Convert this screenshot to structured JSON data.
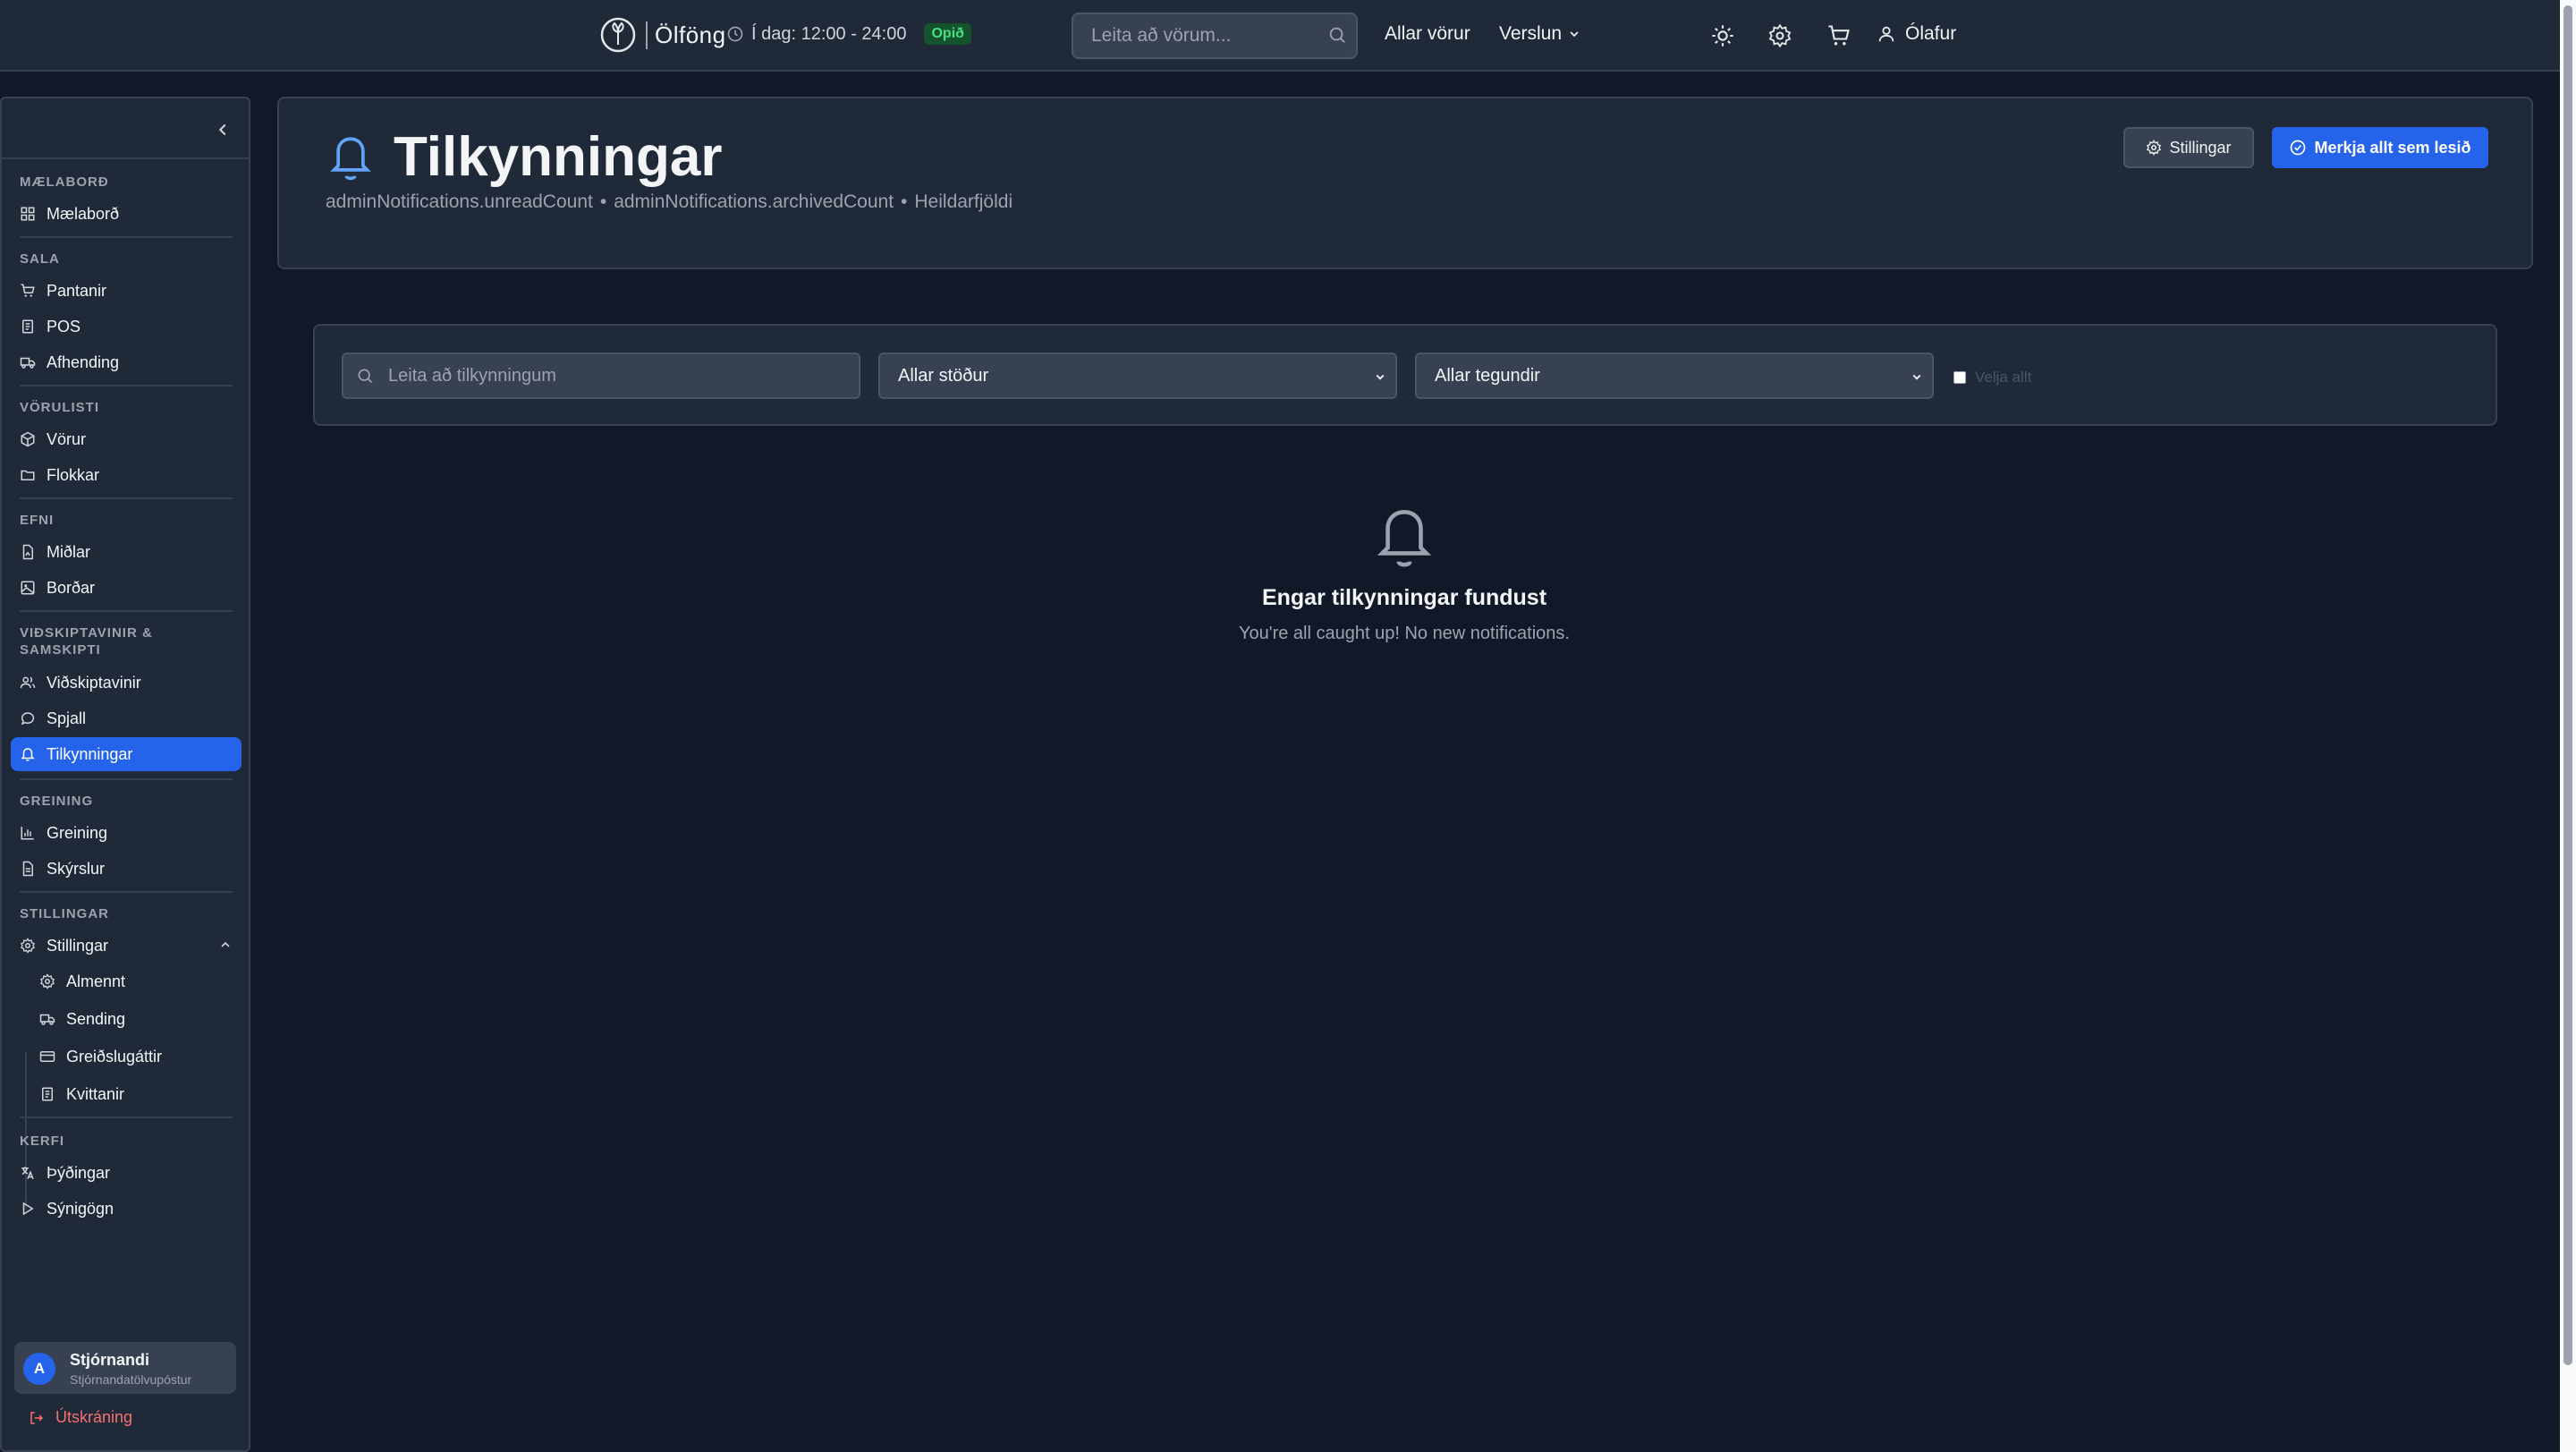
{
  "topbar": {
    "brand": "Ölföng",
    "hours": "Í dag: 12:00 - 24:00",
    "open_badge": "Opið",
    "search_placeholder": "Leita að vörum...",
    "nav_all_products": "Allar vörur",
    "nav_store": "Verslun",
    "user_name": "Ólafur",
    "icons": [
      "clock-icon",
      "search-icon",
      "sun-icon",
      "gear-icon",
      "cart-icon",
      "user-icon"
    ]
  },
  "sidebar": {
    "groups": {
      "dashboard": "MÆLABORÐ",
      "sales": "SALA",
      "catalog": "VÖRULISTI",
      "content": "EFNI",
      "customers": "VIÐSKIPTAVINIR & SAMSKIPTI",
      "analytics": "GREINING",
      "settings": "STILLINGAR",
      "system": "KERFI"
    },
    "items": {
      "dashboard": "Mælaborð",
      "orders": "Pantanir",
      "pos": "POS",
      "delivery": "Afhending",
      "products": "Vörur",
      "categories": "Flokkar",
      "media": "Miðlar",
      "banners": "Borðar",
      "customers": "Viðskiptavinir",
      "chat": "Spjall",
      "notifications": "Tilkynningar",
      "analytics": "Greining",
      "reports": "Skýrslur",
      "settings": "Stillingar",
      "general": "Almennt",
      "shipping": "Sending",
      "payment_methods": "Greiðslugáttir",
      "receipts": "Kvittanir",
      "translations": "Þýðingar",
      "demo_data": "Sýnigögn"
    },
    "active_item": "notifications",
    "user": {
      "avatar_initial": "A",
      "name": "Stjórnandi",
      "email": "Stjórnandatölvupóstur"
    },
    "logout": "Útskráning"
  },
  "header": {
    "title": "Tilkynningar",
    "sub_unread": "adminNotifications.unreadCount",
    "sub_archived": "adminNotifications.archivedCount",
    "sub_total": "Heildarfjöldi",
    "separator": "•",
    "settings_button": "Stillingar",
    "mark_all_button": "Merkja allt sem lesið"
  },
  "filters": {
    "search_placeholder": "Leita að tilkynningum",
    "status_select": "Allar stöður",
    "type_select": "Allar tegundir",
    "select_all": "Velja allt"
  },
  "empty_state": {
    "title": "Engar tilkynningar fundust",
    "message": "You're all caught up! No new notifications."
  },
  "colors": {
    "background": "#111827",
    "panel": "#1f2937",
    "accent": "#2563eb",
    "success": "#4ade80",
    "danger": "#f87171"
  }
}
